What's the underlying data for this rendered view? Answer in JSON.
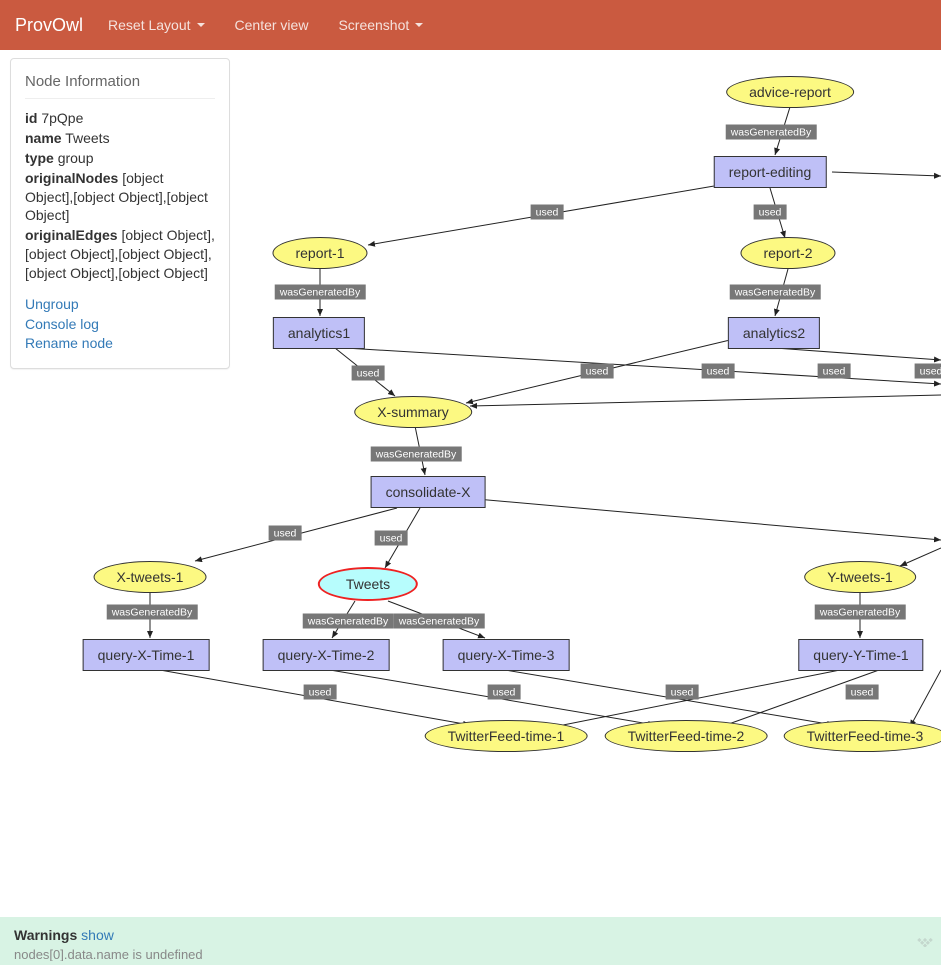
{
  "navbar": {
    "brand": "ProvOwl",
    "items": [
      "Reset Layout",
      "Center view",
      "Screenshot"
    ]
  },
  "info": {
    "title": "Node Information",
    "fields": {
      "id_label": "id",
      "id_value": "7pQpe",
      "name_label": "name",
      "name_value": "Tweets",
      "type_label": "type",
      "type_value": "group",
      "originalNodes_label": "originalNodes",
      "originalNodes_value": "[object Object],[object Object],[object Object]",
      "originalEdges_label": "originalEdges",
      "originalEdges_value": "[object Object],[object Object],[object Object],[object Object],[object Object]"
    },
    "actions": [
      "Ungroup",
      "Console log",
      "Rename node"
    ]
  },
  "nodes": {
    "advice_report": "advice-report",
    "report_editing": "report-editing",
    "report_1": "report-1",
    "report_2": "report-2",
    "analytics1": "analytics1",
    "analytics2": "analytics2",
    "x_summary": "X-summary",
    "consolidate_x": "consolidate-X",
    "x_tweets_1": "X-tweets-1",
    "tweets": "Tweets",
    "y_tweets_1": "Y-tweets-1",
    "query_x_time_1": "query-X-Time-1",
    "query_x_time_2": "query-X-Time-2",
    "query_x_time_3": "query-X-Time-3",
    "query_y_time_1": "query-Y-Time-1",
    "twitterfeed_1": "TwitterFeed-time-1",
    "twitterfeed_2": "TwitterFeed-time-2",
    "twitterfeed_3": "TwitterFeed-time-3"
  },
  "labels": {
    "wasGeneratedBy": "wasGeneratedBy",
    "used": "used"
  },
  "footer": {
    "warnings_label": "Warnings",
    "show": "show",
    "sub_text": "nodes[0].data.name is undefined"
  }
}
